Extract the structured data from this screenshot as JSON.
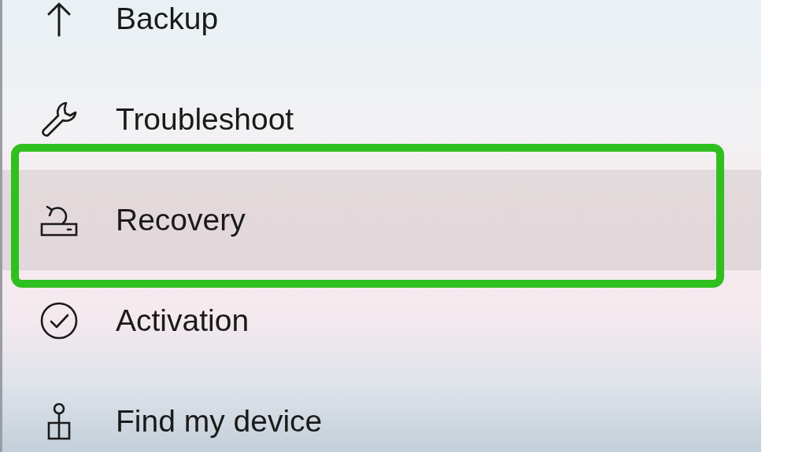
{
  "sidebar": {
    "items": [
      {
        "kind": "backup",
        "label": "Backup",
        "selected": false,
        "highlighted": false
      },
      {
        "kind": "troubleshoot",
        "label": "Troubleshoot",
        "selected": false,
        "highlighted": false
      },
      {
        "kind": "recovery",
        "label": "Recovery",
        "selected": true,
        "highlighted": true
      },
      {
        "kind": "activation",
        "label": "Activation",
        "selected": false,
        "highlighted": false
      },
      {
        "kind": "finddevice",
        "label": "Find my device",
        "selected": false,
        "highlighted": false
      }
    ]
  }
}
